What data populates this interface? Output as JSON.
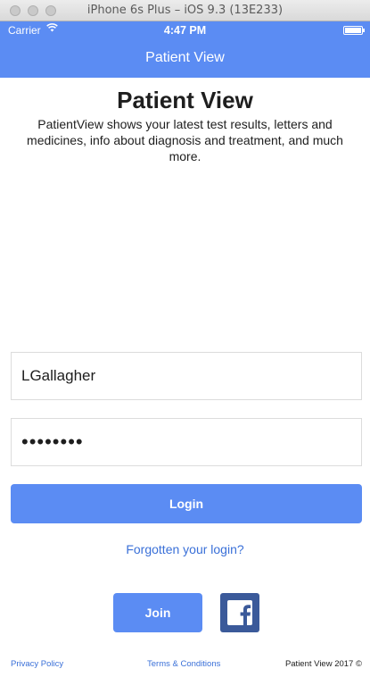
{
  "simulator": {
    "title": "iPhone 6s Plus – iOS 9.3 (13E233)"
  },
  "status_bar": {
    "carrier": "Carrier",
    "time": "4:47 PM"
  },
  "nav": {
    "title": "Patient View"
  },
  "main": {
    "heading": "Patient View",
    "intro": "PatientView shows your latest test results, letters and medicines, info about diagnosis and treatment, and much more."
  },
  "form": {
    "username_value": "LGallagher",
    "password_value": "••••••••",
    "login_label": "Login",
    "forgot_label": "Forgotten your login?"
  },
  "actions": {
    "join_label": "Join"
  },
  "footer": {
    "privacy": "Privacy Policy",
    "terms": "Terms & Conditions",
    "copyright": "Patient View 2017 ©"
  },
  "colors": {
    "accent": "#5b8cf3",
    "link": "#3a70d8",
    "facebook": "#3b5a9a"
  }
}
